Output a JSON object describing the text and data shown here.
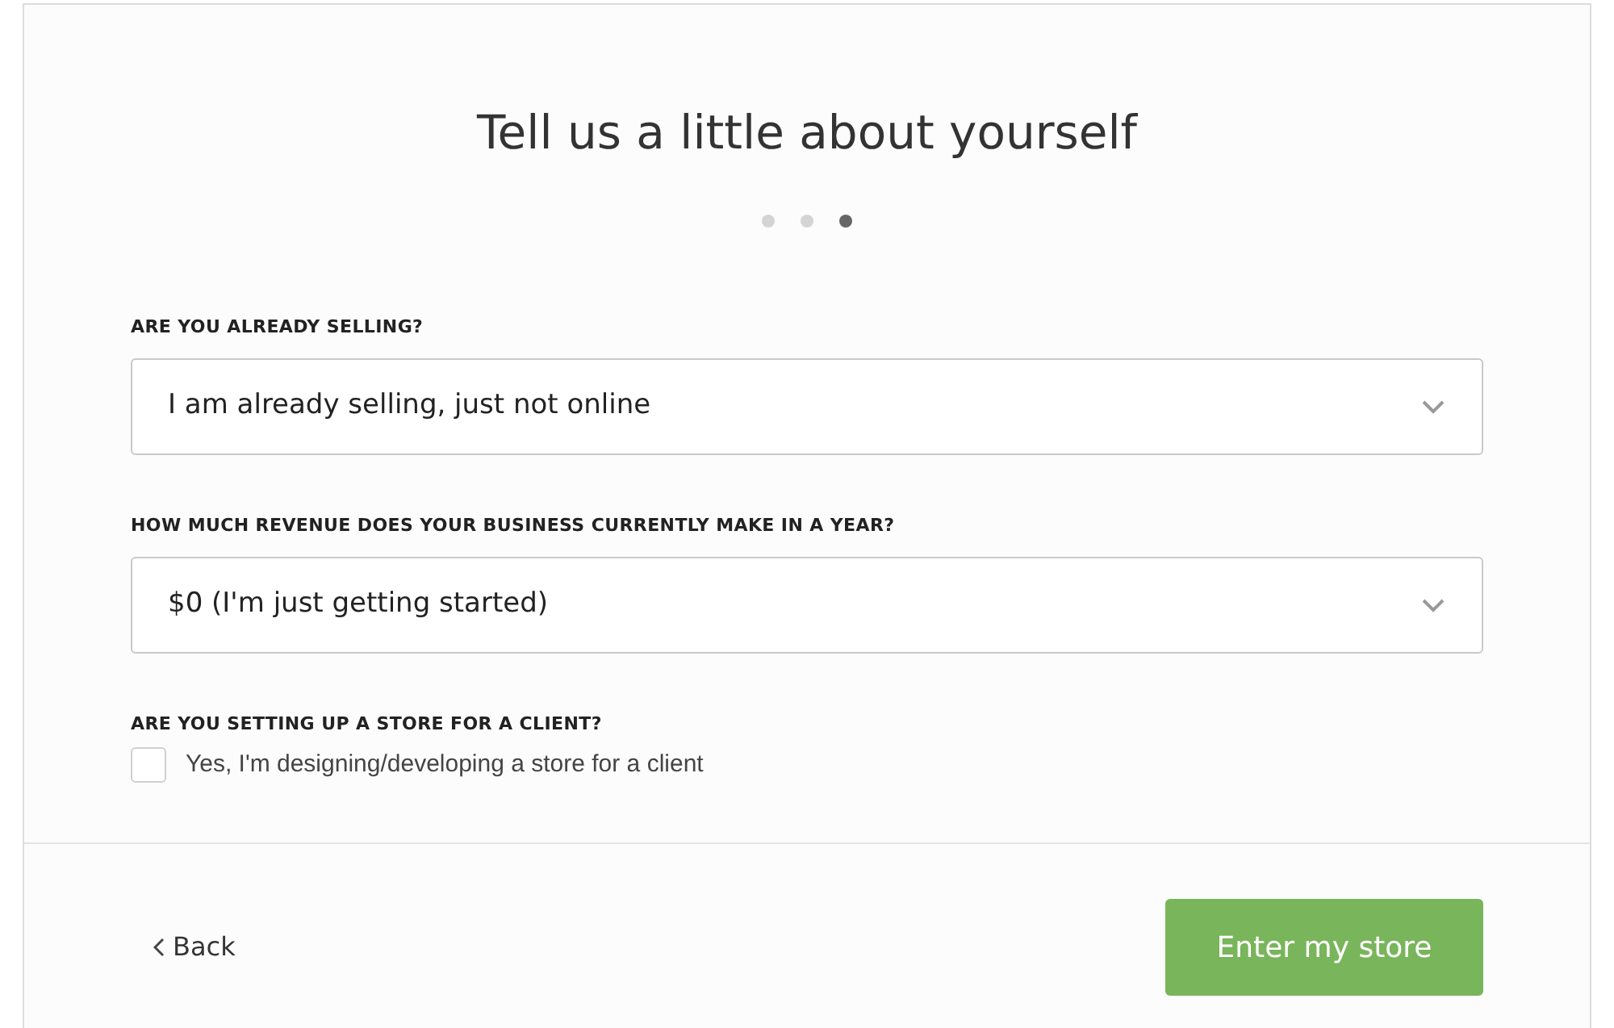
{
  "title": "Tell us a little about yourself",
  "steps": [
    {
      "selected": false
    },
    {
      "selected": false
    },
    {
      "selected": true
    }
  ],
  "questions": [
    {
      "kind": "select",
      "label": "ARE YOU ALREADY SELLING?",
      "value": "I am already selling, just not online"
    },
    {
      "kind": "select",
      "label": "HOW MUCH REVENUE DOES YOUR BUSINESS CURRENTLY MAKE IN A YEAR?",
      "value": "$0 (I'm just getting started)"
    },
    {
      "kind": "checkbox",
      "label": "ARE YOU SETTING UP A STORE FOR A CLIENT?",
      "option": "Yes, I'm designing/developing a store for a client",
      "checked": false
    }
  ],
  "footer": {
    "back": "Back",
    "submit": "Enter my store"
  }
}
